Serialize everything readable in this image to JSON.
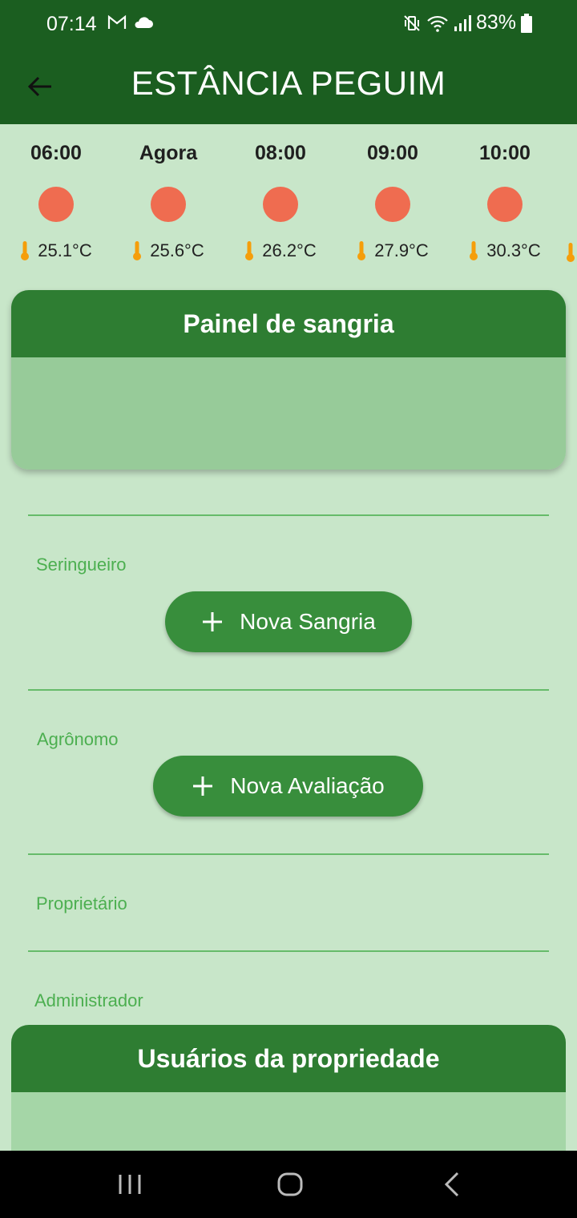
{
  "status_bar": {
    "time": "07:14",
    "battery": "83%"
  },
  "app_bar": {
    "title": "ESTÂNCIA PEGUIM"
  },
  "forecast": [
    {
      "time": "06:00",
      "temp": "25.1°C"
    },
    {
      "time": "Agora",
      "temp": "25.6°C"
    },
    {
      "time": "08:00",
      "temp": "26.2°C"
    },
    {
      "time": "09:00",
      "temp": "27.9°C"
    },
    {
      "time": "10:00",
      "temp": "30.3°C"
    }
  ],
  "panel": {
    "title": "Painel de sangria"
  },
  "roles": {
    "seringueiro": "Seringueiro",
    "nova_sangria": "Nova Sangria",
    "agronomo": "Agrônomo",
    "nova_avaliacao": "Nova Avaliação",
    "proprietario": "Proprietário",
    "administrador": "Administrador"
  },
  "users_card": {
    "title": "Usuários da propriedade"
  },
  "colors": {
    "primary_dark": "#1b5e20",
    "primary": "#2e7d32",
    "background": "#c8e6c9",
    "sun": "#ef6c50",
    "thermometer": "#f59e0b"
  }
}
